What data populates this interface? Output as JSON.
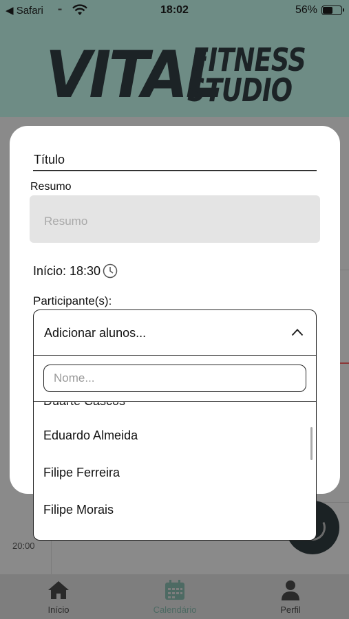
{
  "status_bar": {
    "back_app": "◀ Safari",
    "time": "18:02",
    "battery_percent": "56%",
    "battery_level": 0.56
  },
  "header": {
    "logo_word_1": "VITAL",
    "logo_word_2": "FITNESS",
    "logo_word_3": "STUDIO"
  },
  "calendar": {
    "hour_label": "20:00"
  },
  "modal": {
    "title_value": "Título",
    "summary_label": "Resumo",
    "summary_placeholder": "Resumo",
    "start_label": "Início: 18:30",
    "participants_label": "Participante(s):"
  },
  "dropdown": {
    "header_text": "Adicionar alunos...",
    "search_placeholder": "Nome...",
    "items": [
      "Duarte Cascos",
      "Eduardo Almeida",
      "Filipe Ferreira",
      "Filipe Morais"
    ]
  },
  "tabbar": {
    "tabs": [
      {
        "label": "Início",
        "icon": "home-icon"
      },
      {
        "label": "Calendário",
        "icon": "calendar-icon"
      },
      {
        "label": "Perfil",
        "icon": "person-icon"
      }
    ],
    "active_tab": "Calendário",
    "active_color": "#4d6a63"
  }
}
